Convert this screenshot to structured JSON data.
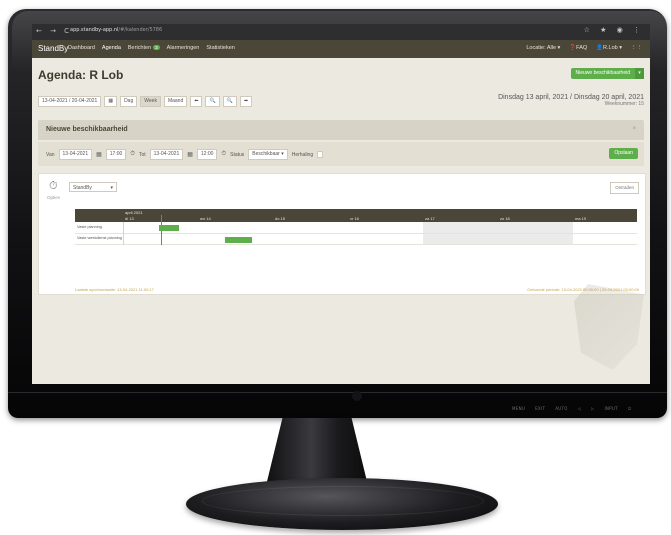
{
  "browser": {
    "nav_icons": "← → C",
    "url_main": "app.standby-app.nl",
    "url_path": "/#/kalender/5786",
    "actions": "☆ ★ ◉ ⋮"
  },
  "app": {
    "brand": "StandBy",
    "nav": [
      {
        "label": "Dashboard"
      },
      {
        "label": "Agenda"
      },
      {
        "label": "Berichten",
        "badge": "3"
      },
      {
        "label": "Alarmeringen"
      },
      {
        "label": "Statistieken"
      }
    ],
    "right": {
      "locatie": "Locatie: Alle ▾",
      "faq": "❓FAQ",
      "user": "👤R.Lob ▾",
      "menu": "⋮⋮"
    }
  },
  "page": {
    "title": "Agenda: R Lob",
    "new_button": "Nieuwe beschikbaarheid",
    "new_caret": "▾"
  },
  "toolbar": {
    "range": "13-04-2021 / 20-04-2021",
    "calendar_icon": "▦",
    "views": [
      "Dag",
      "Week",
      "Maand"
    ],
    "active_view": "Week",
    "arrows": [
      "⬅",
      "🔍",
      "🔍",
      "➡"
    ]
  },
  "header_date": {
    "main": "Dinsdag 13 april, 2021 / Dinsdag 20 april, 2021",
    "week": "Weeknummer: 15"
  },
  "new_panel": {
    "title": "Nieuwe beschikbaarheid",
    "close": "×",
    "van_label": "Van",
    "van_date": "13-04-2021",
    "van_time": "17:00",
    "tot_label": "Tot",
    "tot_date": "13-04-2021",
    "tot_time": "12:00",
    "status_label": "Status",
    "status_value": "Beschikbaar",
    "status_caret": "▾",
    "herhaling_label": "Herhaling",
    "save_button": "Opslaan"
  },
  "schedule": {
    "clock_icon": "⏱",
    "clock_label": "Opties",
    "type_value": "StandBy",
    "type_caret": "▾",
    "ontraden_button": "Ontraden",
    "month_label": "april 2021",
    "days": [
      "di 13",
      "wo 14",
      "do 15",
      "vr 16",
      "za 17",
      "zo 18",
      "ma 19"
    ],
    "rows": [
      "Vaste planning",
      "Vaste weekdienst planning"
    ],
    "footer_left": "Laatste synchronisatie: 13-04-2021 11:00:17",
    "footer_right": "Getoonde periode: 13-04-2021 00:00:00 | 20-04-2021 00:00:00"
  },
  "monitor": {
    "buttons": [
      "MENU",
      "EXIT",
      "AUTO",
      "◁",
      "▷",
      "INPUT",
      "⏻"
    ]
  }
}
